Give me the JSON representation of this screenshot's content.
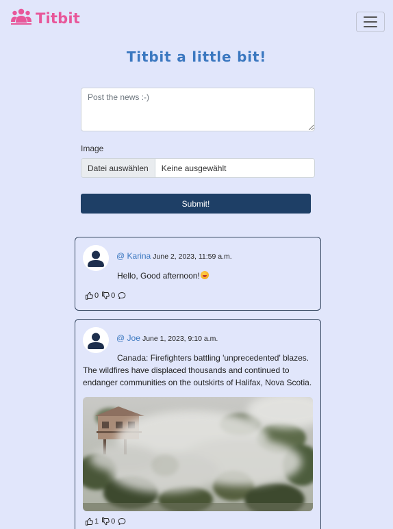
{
  "navbar": {
    "brand": "Titbit",
    "brand_icon": "users-icon",
    "toggler_icon": "hamburger-menu-icon"
  },
  "header": {
    "title": "Titbit a little bit!"
  },
  "form": {
    "textarea_placeholder": "Post the news :-)",
    "image_label": "Image",
    "file_button": "Datei auswählen",
    "file_status": "Keine ausgewählt",
    "submit_label": "Submit!"
  },
  "posts": [
    {
      "author": "@ Karina",
      "date": "June 2, 2023, 11:59 a.m.",
      "text": "Hello, Good afternoon!",
      "likes": "0",
      "dislikes": "0",
      "has_emoji": true
    },
    {
      "author": "@ Joe",
      "date": "June 1, 2023, 9:10 a.m.",
      "text": "Canada: Firefighters battling 'unprecedented' blazes. The wildfires have displaced thousands and continued to endanger communities on the outskirts of Halifax, Nova Scotia.",
      "likes": "1",
      "dislikes": "0",
      "image": "wildfire-smoke-photo"
    }
  ],
  "colors": {
    "background": "#e1e6fb",
    "brand": "#e8579a",
    "title": "#3b78c0",
    "submit": "#1e3f66",
    "link": "#3b78c0"
  }
}
